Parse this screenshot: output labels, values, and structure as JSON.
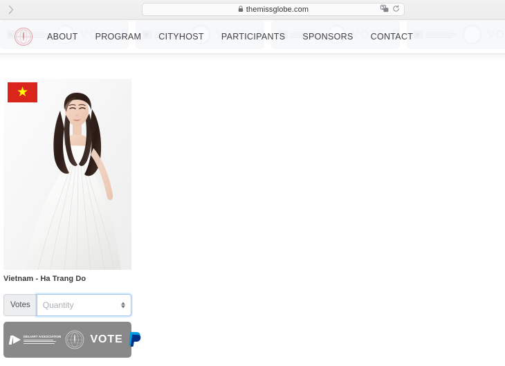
{
  "browser": {
    "forward_icon": "chevron-right-icon",
    "url": "themissglobe.com",
    "lock_icon": "lock-icon",
    "translate_icon": "translate-icon",
    "reload_icon": "reload-icon"
  },
  "site_header": {
    "logo_alt": "the-miss-globe-logo",
    "nav": [
      {
        "label": "ABOUT"
      },
      {
        "label": "PROGRAM"
      },
      {
        "label": "CITYHOST"
      },
      {
        "label": "PARTICIPANTS"
      },
      {
        "label": "SPONSORS"
      },
      {
        "label": "CONTACT"
      }
    ],
    "watermark": {
      "brand": "DELIART ASSOCIATION",
      "vote_word": "VOTE",
      "paypal_glyph": "P"
    }
  },
  "contestant": {
    "flag": "vietnam-flag",
    "flag_star": "★",
    "flag_red": "#da251d",
    "flag_yellow": "#ffff00",
    "name": "Vietnam - Ha Trang Do",
    "photo_alt": "contestant-portrait-white-gown"
  },
  "vote_form": {
    "votes_label": "Votes",
    "quantity_value": "",
    "quantity_placeholder": "Quantity",
    "stepper_up": "increment",
    "stepper_down": "decrement",
    "focus_color": "#9ec5f0"
  },
  "vote_button": {
    "deliart_name": "DELIART ASSOCIATION",
    "vote_label": "VOTE",
    "paypal_glyph": "P",
    "background": "#898989",
    "paypal_blue": "#009cde",
    "paypal_navy": "#003087"
  }
}
